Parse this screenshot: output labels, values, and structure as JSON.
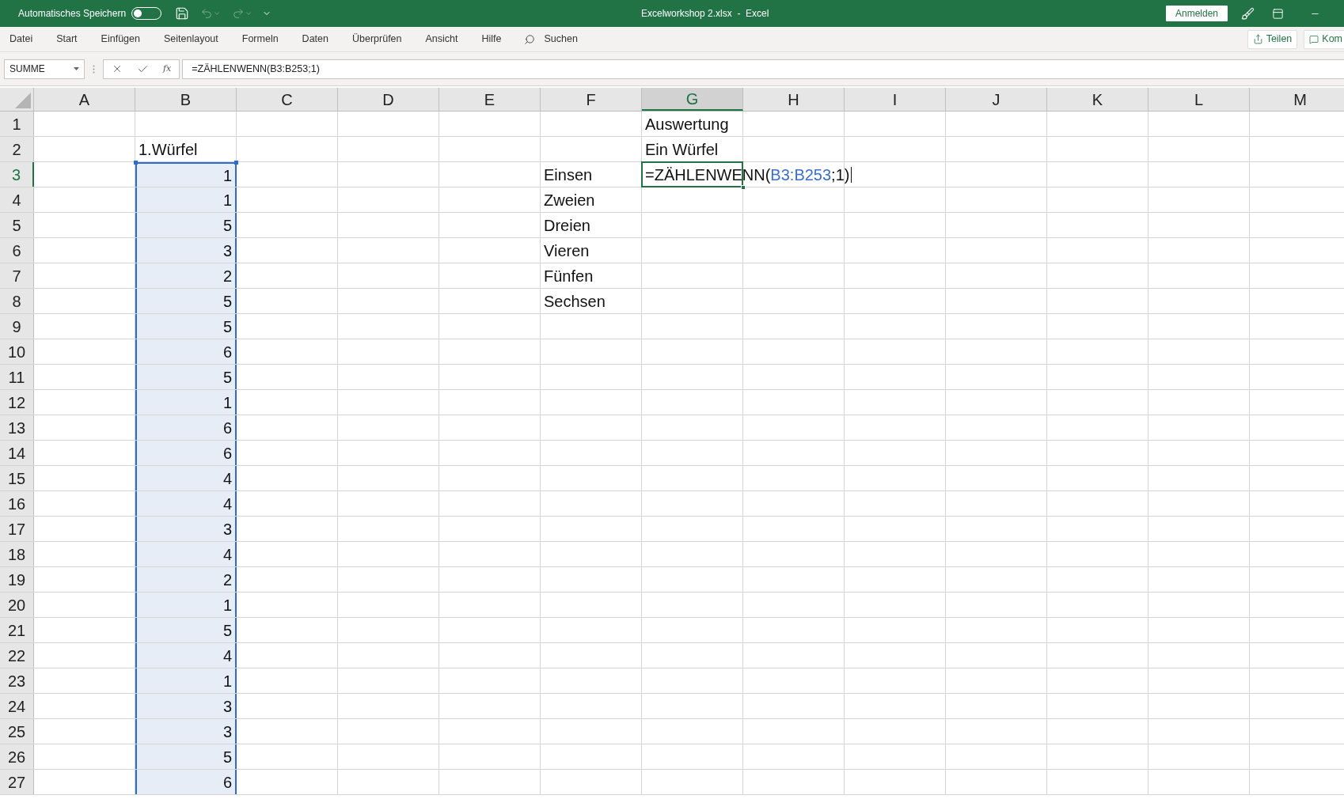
{
  "title_bar": {
    "autosave": {
      "label": "Automatisches Speichern",
      "on": false
    },
    "title": "Excelworkshop 2.xlsx  -  Excel",
    "sign_in": "Anmelden"
  },
  "ribbon": {
    "tabs": [
      {
        "label": "Datei",
        "selected": false
      },
      {
        "label": "Start",
        "selected": false
      },
      {
        "label": "Einfügen",
        "selected": false
      },
      {
        "label": "Seitenlayout",
        "selected": false
      },
      {
        "label": "Formeln",
        "selected": false
      },
      {
        "label": "Daten",
        "selected": false
      },
      {
        "label": "Überprüfen",
        "selected": false
      },
      {
        "label": "Ansicht",
        "selected": false
      },
      {
        "label": "Hilfe",
        "selected": false
      }
    ],
    "search": "Suchen",
    "share": "Teilen",
    "comments": "Kom"
  },
  "formula_bar": {
    "name_box": "SUMME",
    "function_label": "fx",
    "formula": "=ZÄHLENWENN(B3:B253;1)"
  },
  "sheet": {
    "columns": [
      {
        "label": "A",
        "selected": false,
        "referenced": false
      },
      {
        "label": "B",
        "selected": false,
        "referenced": true
      },
      {
        "label": "C",
        "selected": false,
        "referenced": false
      },
      {
        "label": "D",
        "selected": false,
        "referenced": false
      },
      {
        "label": "E",
        "selected": false,
        "referenced": false
      },
      {
        "label": "F",
        "selected": false,
        "referenced": false
      },
      {
        "label": "G",
        "selected": true,
        "referenced": false
      },
      {
        "label": "H",
        "selected": false,
        "referenced": false
      },
      {
        "label": "I",
        "selected": false,
        "referenced": false
      },
      {
        "label": "J",
        "selected": false,
        "referenced": false
      },
      {
        "label": "K",
        "selected": false,
        "referenced": false
      },
      {
        "label": "L",
        "selected": false,
        "referenced": false
      },
      {
        "label": "M",
        "selected": false,
        "referenced": false
      }
    ],
    "rows": [
      {
        "label": "1",
        "selected": false,
        "referenced": false,
        "cells": {
          "g": "Auswertung"
        }
      },
      {
        "label": "2",
        "selected": false,
        "referenced": false,
        "cells": {
          "b": "1.Würfel",
          "g": "Ein Würfel"
        }
      },
      {
        "label": "3",
        "selected": true,
        "referenced": true,
        "cells": {
          "b": "1",
          "f": "Einsen"
        },
        "editing": {
          "parts": [
            {
              "kind": "plain",
              "text": "=ZÄHLENWENN("
            },
            {
              "kind": "reference",
              "text": "B3:B253"
            },
            {
              "kind": "plain",
              "text": ";1)"
            }
          ]
        }
      },
      {
        "label": "4",
        "selected": false,
        "referenced": true,
        "cells": {
          "b": "1",
          "f": "Zweien"
        }
      },
      {
        "label": "5",
        "selected": false,
        "referenced": true,
        "cells": {
          "b": "5",
          "f": "Dreien"
        }
      },
      {
        "label": "6",
        "selected": false,
        "referenced": true,
        "cells": {
          "b": "3",
          "f": "Vieren"
        }
      },
      {
        "label": "7",
        "selected": false,
        "referenced": true,
        "cells": {
          "b": "2",
          "f": "Fünfen"
        }
      },
      {
        "label": "8",
        "selected": false,
        "referenced": true,
        "cells": {
          "b": "5",
          "f": "Sechsen"
        }
      },
      {
        "label": "9",
        "selected": false,
        "referenced": true,
        "cells": {
          "b": "5"
        }
      },
      {
        "label": "10",
        "selected": false,
        "referenced": true,
        "cells": {
          "b": "6"
        }
      },
      {
        "label": "11",
        "selected": false,
        "referenced": true,
        "cells": {
          "b": "5"
        }
      },
      {
        "label": "12",
        "selected": false,
        "referenced": true,
        "cells": {
          "b": "1"
        }
      },
      {
        "label": "13",
        "selected": false,
        "referenced": true,
        "cells": {
          "b": "6"
        }
      },
      {
        "label": "14",
        "selected": false,
        "referenced": true,
        "cells": {
          "b": "6"
        }
      },
      {
        "label": "15",
        "selected": false,
        "referenced": true,
        "cells": {
          "b": "4"
        }
      },
      {
        "label": "16",
        "selected": false,
        "referenced": true,
        "cells": {
          "b": "4"
        }
      },
      {
        "label": "17",
        "selected": false,
        "referenced": true,
        "cells": {
          "b": "3"
        }
      },
      {
        "label": "18",
        "selected": false,
        "referenced": true,
        "cells": {
          "b": "4"
        }
      },
      {
        "label": "19",
        "selected": false,
        "referenced": true,
        "cells": {
          "b": "2"
        }
      },
      {
        "label": "20",
        "selected": false,
        "referenced": true,
        "cells": {
          "b": "1"
        }
      },
      {
        "label": "21",
        "selected": false,
        "referenced": true,
        "cells": {
          "b": "5"
        }
      },
      {
        "label": "22",
        "selected": false,
        "referenced": true,
        "cells": {
          "b": "4"
        }
      },
      {
        "label": "23",
        "selected": false,
        "referenced": true,
        "cells": {
          "b": "1"
        }
      },
      {
        "label": "24",
        "selected": false,
        "referenced": true,
        "cells": {
          "b": "3"
        }
      },
      {
        "label": "25",
        "selected": false,
        "referenced": true,
        "cells": {
          "b": "3"
        }
      },
      {
        "label": "26",
        "selected": false,
        "referenced": true,
        "cells": {
          "b": "5"
        }
      },
      {
        "label": "27",
        "selected": false,
        "referenced": true,
        "cells": {
          "b": "6"
        }
      }
    ]
  }
}
